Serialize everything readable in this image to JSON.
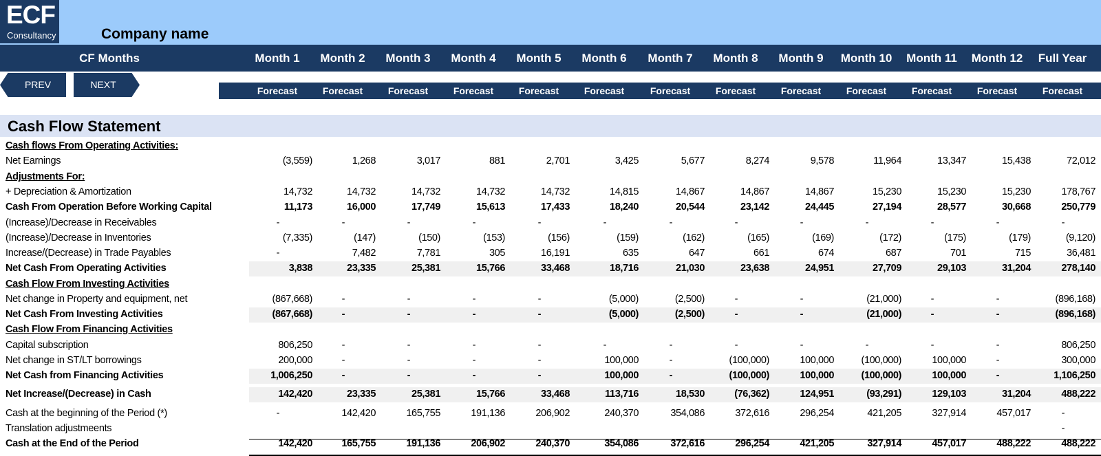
{
  "brand": {
    "logo_main": "ECF",
    "logo_sub": "Consultancy",
    "company": "Company name"
  },
  "nav": {
    "title": "CF Months",
    "prev_label": "PREV",
    "next_label": "NEXT"
  },
  "columns": [
    "Month 1",
    "Month 2",
    "Month 3",
    "Month 4",
    "Month 5",
    "Month 6",
    "Month 7",
    "Month 8",
    "Month 9",
    "Month 10",
    "Month 11",
    "Month 12",
    "Full Year"
  ],
  "forecast_label": "Forecast",
  "colors": {
    "navy": "#1b3a63",
    "light_blue": "#9ccbfb",
    "section_band": "#dbe3f4",
    "row_shade": "#f0f0f0"
  },
  "statement": {
    "title": "Cash Flow Statement",
    "rows": [
      {
        "label": "Cash flows From Operating Activities:",
        "style": "header",
        "values": []
      },
      {
        "label": "Net Earnings",
        "style": "normal",
        "values": [
          "(3,559)",
          "1,268",
          "3,017",
          "881",
          "2,701",
          "3,425",
          "5,677",
          "8,274",
          "9,578",
          "11,964",
          "13,347",
          "15,438",
          "72,012"
        ]
      },
      {
        "label": "Adjustments For:",
        "style": "header",
        "values": []
      },
      {
        "label": " + Depreciation & Amortization",
        "style": "normal",
        "values": [
          "14,732",
          "14,732",
          "14,732",
          "14,732",
          "14,732",
          "14,815",
          "14,867",
          "14,867",
          "14,867",
          "15,230",
          "15,230",
          "15,230",
          "178,767"
        ]
      },
      {
        "label": "Cash From Operation Before Working Capital",
        "style": "bold",
        "values": [
          "11,173",
          "16,000",
          "17,749",
          "15,613",
          "17,433",
          "18,240",
          "20,544",
          "23,142",
          "24,445",
          "27,194",
          "28,577",
          "30,668",
          "250,779"
        ]
      },
      {
        "label": "(Increase)/Decrease in Receivables",
        "style": "normal",
        "values": [
          "-",
          "-",
          "-",
          "-",
          "-",
          "-",
          "-",
          "-",
          "-",
          "-",
          "-",
          "-",
          "-"
        ]
      },
      {
        "label": "(Increase)/Decrease in Inventories",
        "style": "normal",
        "values": [
          "(7,335)",
          "(147)",
          "(150)",
          "(153)",
          "(156)",
          "(159)",
          "(162)",
          "(165)",
          "(169)",
          "(172)",
          "(175)",
          "(179)",
          "(9,120)"
        ]
      },
      {
        "label": "Increase/(Decrease) in Trade Payables",
        "style": "normal",
        "values": [
          "-",
          "7,482",
          "7,781",
          "305",
          "16,191",
          "635",
          "647",
          "661",
          "674",
          "687",
          "701",
          "715",
          "36,481"
        ]
      },
      {
        "label": "Net Cash From Operating Activities",
        "style": "total",
        "values": [
          "3,838",
          "23,335",
          "25,381",
          "15,766",
          "33,468",
          "18,716",
          "21,030",
          "23,638",
          "24,951",
          "27,709",
          "29,103",
          "31,204",
          "278,140"
        ]
      },
      {
        "label": "Cash Flow From Investing Activities",
        "style": "header",
        "values": []
      },
      {
        "label": "Net change in Property and equipment, net",
        "style": "normal",
        "values": [
          "(867,668)",
          "-",
          "-",
          "-",
          "-",
          "(5,000)",
          "(2,500)",
          "-",
          "-",
          "(21,000)",
          "-",
          "-",
          "(896,168)"
        ]
      },
      {
        "label": "Net Cash From Investing Activities",
        "style": "total",
        "values": [
          "(867,668)",
          "-",
          "-",
          "-",
          "-",
          "(5,000)",
          "(2,500)",
          "-",
          "-",
          "(21,000)",
          "-",
          "-",
          "(896,168)"
        ]
      },
      {
        "label": "Cash Flow From Financing Activities",
        "style": "header",
        "values": []
      },
      {
        "label": "Capital subscription",
        "style": "normal",
        "values": [
          "806,250",
          "-",
          "-",
          "-",
          "-",
          "-",
          "-",
          "-",
          "-",
          "-",
          "-",
          "-",
          "806,250"
        ]
      },
      {
        "label": "Net change in ST/LT borrowings",
        "style": "normal",
        "values": [
          "200,000",
          "-",
          "-",
          "-",
          "-",
          "100,000",
          "-",
          "(100,000)",
          "100,000",
          "(100,000)",
          "100,000",
          "-",
          "300,000"
        ]
      },
      {
        "label": "Net Cash from Financing Activities",
        "style": "total",
        "values": [
          "1,006,250",
          "-",
          "-",
          "-",
          "-",
          "100,000",
          "-",
          "(100,000)",
          "100,000",
          "(100,000)",
          "100,000",
          "-",
          "1,106,250"
        ]
      },
      {
        "label": "Net Increase/(Decrease) in Cash",
        "style": "total",
        "values": [
          "142,420",
          "23,335",
          "25,381",
          "15,766",
          "33,468",
          "113,716",
          "18,530",
          "(76,362)",
          "124,951",
          "(93,291)",
          "129,103",
          "31,204",
          "488,222"
        ]
      },
      {
        "label": "Cash at the beginning of the Period (*)",
        "style": "normal",
        "values": [
          "-",
          "142,420",
          "165,755",
          "191,136",
          "206,902",
          "240,370",
          "354,086",
          "372,616",
          "296,254",
          "421,205",
          "327,914",
          "457,017",
          "-"
        ]
      },
      {
        "label": "Translation adjustmeents",
        "style": "normal",
        "values": [
          "",
          "",
          "",
          "",
          "",
          "",
          "",
          "",
          "",
          "",
          "",
          "",
          "-"
        ]
      },
      {
        "label": "Cash at the End of the Period",
        "style": "final",
        "values": [
          "142,420",
          "165,755",
          "191,136",
          "206,902",
          "240,370",
          "354,086",
          "372,616",
          "296,254",
          "421,205",
          "327,914",
          "457,017",
          "488,222",
          "488,222"
        ]
      }
    ]
  }
}
